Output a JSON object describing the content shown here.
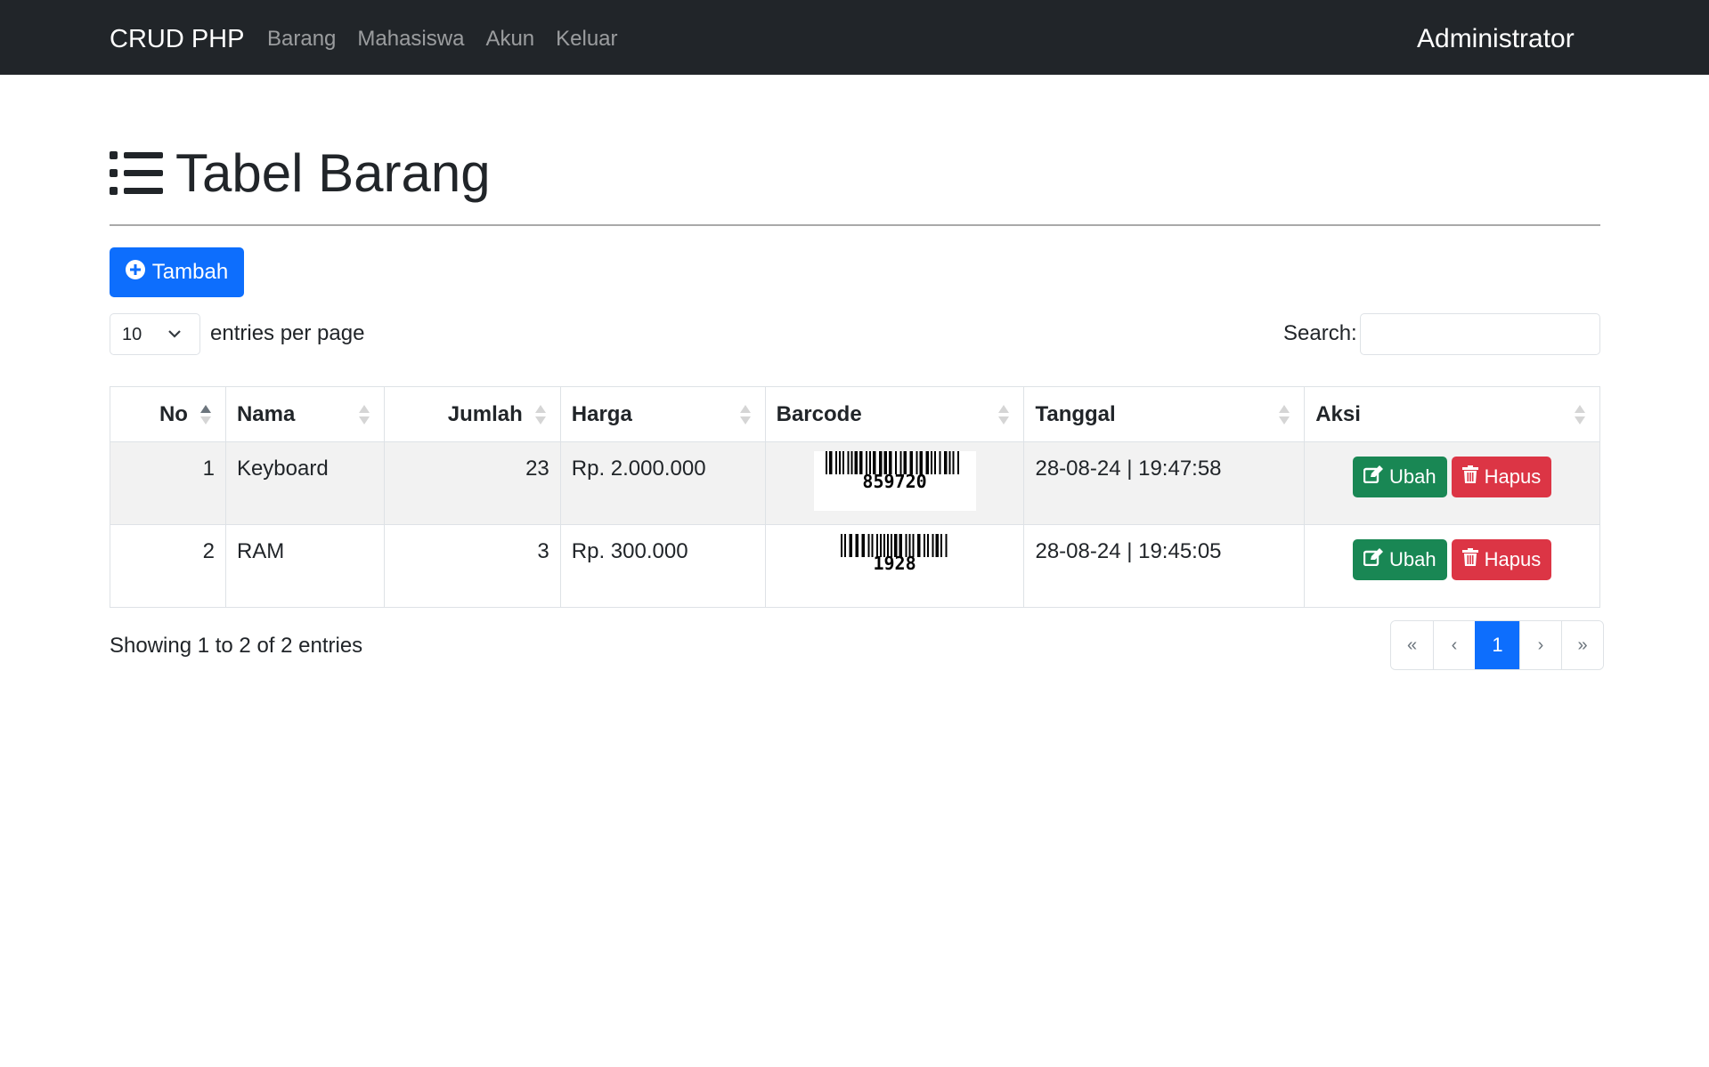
{
  "navbar": {
    "brand": "CRUD PHP",
    "links": [
      "Barang",
      "Mahasiswa",
      "Akun",
      "Keluar"
    ],
    "user": "Administrator"
  },
  "page": {
    "title": "Tabel Barang",
    "title_icon": "list-icon",
    "add_button": "Tambah",
    "add_icon": "plus-circle-icon"
  },
  "controls": {
    "entries_value": "10",
    "entries_label": "entries per page",
    "search_label": "Search:",
    "search_value": ""
  },
  "table": {
    "columns": [
      "No",
      "Nama",
      "Jumlah",
      "Harga",
      "Barcode",
      "Tanggal",
      "Aksi"
    ],
    "sorted_column": "No",
    "sort_direction": "ascending",
    "rows": [
      {
        "no": "1",
        "nama": "Keyboard",
        "jumlah": "23",
        "harga": "Rp. 2.000.000",
        "barcode": "859720",
        "tanggal": "28-08-24 | 19:47:58",
        "ubah": "Ubah",
        "hapus": "Hapus"
      },
      {
        "no": "2",
        "nama": "RAM",
        "jumlah": "3",
        "harga": "Rp. 300.000",
        "barcode": "1928",
        "tanggal": "28-08-24 | 19:45:05",
        "ubah": "Ubah",
        "hapus": "Hapus"
      }
    ]
  },
  "footer": {
    "info": "Showing 1 to 2 of 2 entries",
    "pagination": [
      "«",
      "‹",
      "1",
      "›",
      "»"
    ],
    "active_page": "1"
  },
  "colors": {
    "navbar": "#212529",
    "primary": "#0d6efd",
    "success": "#198754",
    "danger": "#dc3545"
  }
}
